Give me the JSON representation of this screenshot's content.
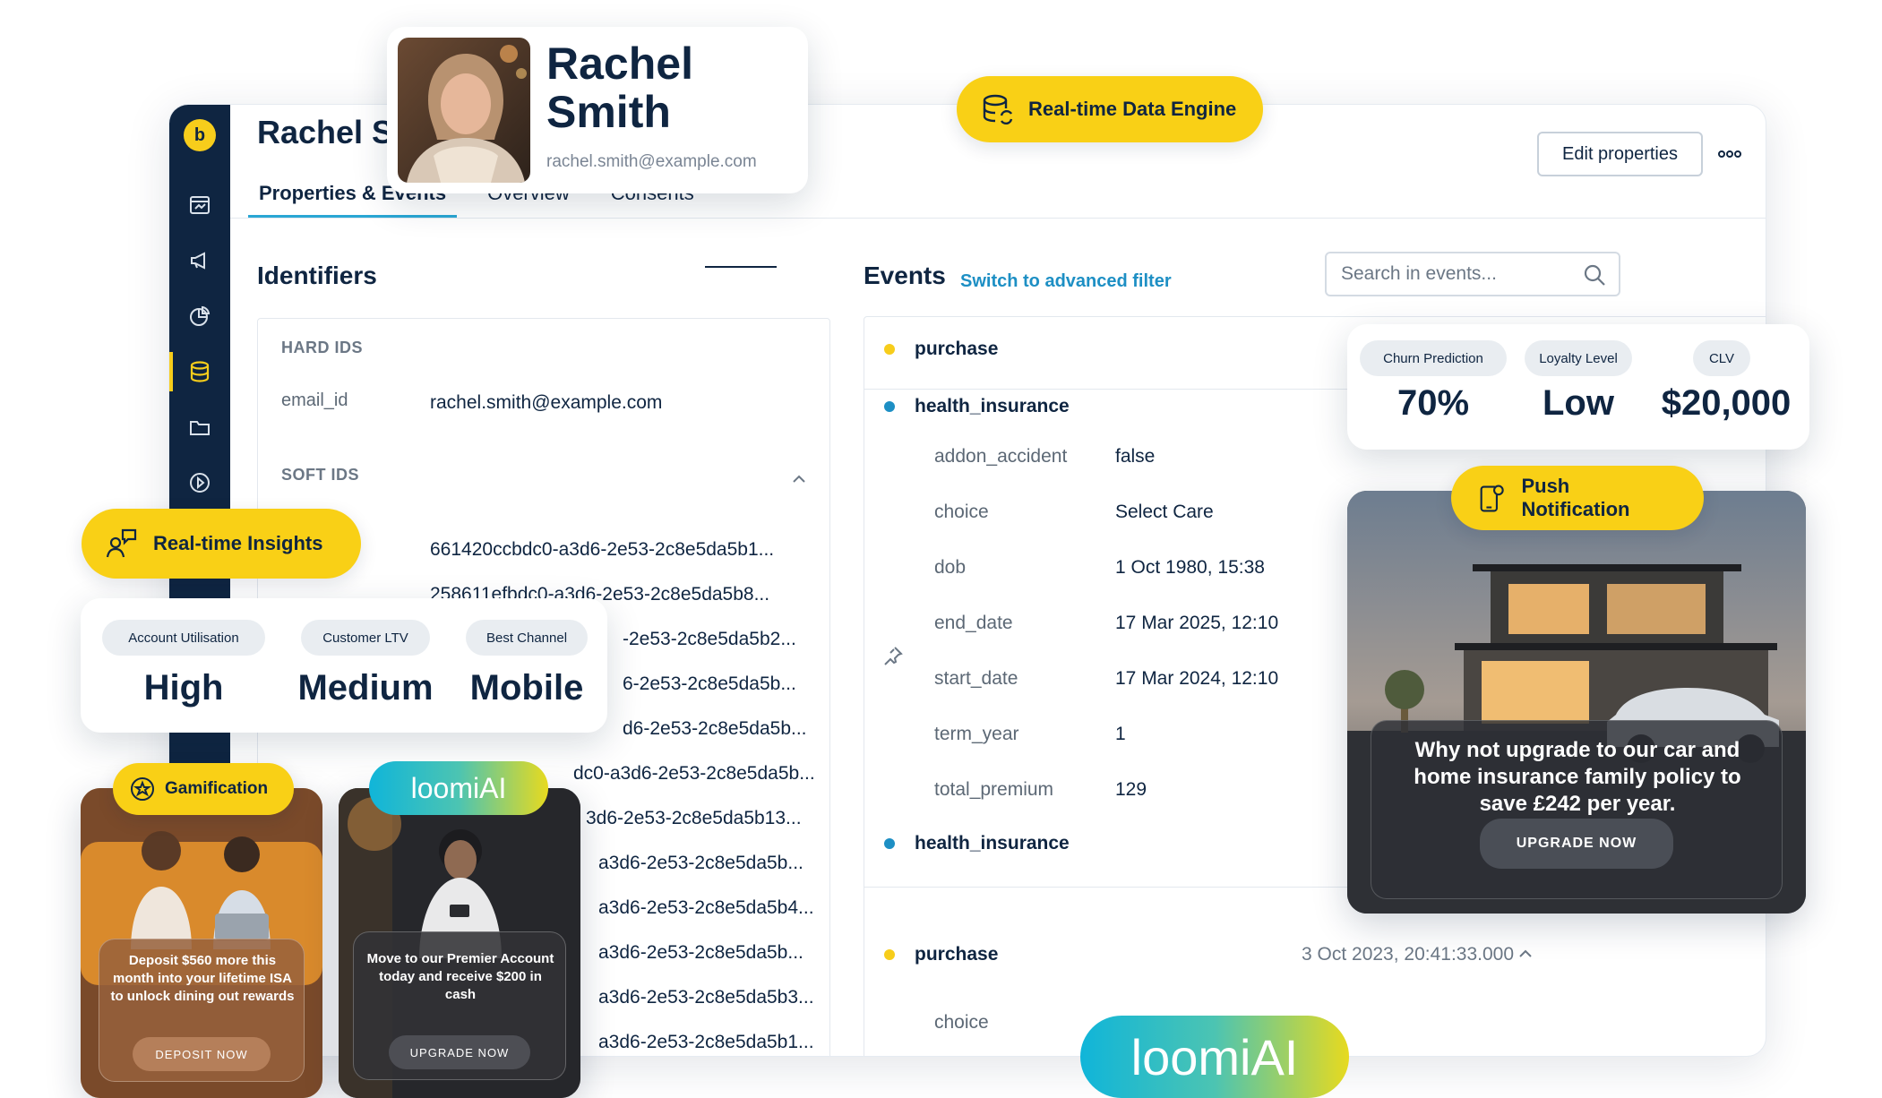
{
  "app": {
    "profile_name": "Rachel S",
    "tabs": [
      {
        "label": "Properties & Events",
        "active": true
      },
      {
        "label": "Overview"
      },
      {
        "label": "Consents"
      }
    ],
    "edit_button": "Edit properties",
    "logo_glyph": "b"
  },
  "identifiers": {
    "title": "Identifiers",
    "hard_ids_label": "HARD IDS",
    "email_key": "email_id",
    "email_value": "rachel.smith@example.com",
    "soft_ids_label": "SOFT IDS",
    "soft_ids": [
      "661420ccbdc0-a3d6-2e53-2c8e5da5b1...",
      "258611efbdc0-a3d6-2e53-2c8e5da5b8...",
      "-2e53-2c8e5da5b2...",
      "6-2e53-2c8e5da5b...",
      "d6-2e53-2c8e5da5b...",
      "dc0-a3d6-2e53-2c8e5da5b...",
      "3d6-2e53-2c8e5da5b13...",
      "a3d6-2e53-2c8e5da5b...",
      "a3d6-2e53-2c8e5da5b4...",
      "a3d6-2e53-2c8e5da5b...",
      "a3d6-2e53-2c8e5da5b3...",
      "a3d6-2e53-2c8e5da5b1..."
    ]
  },
  "events": {
    "title": "Events",
    "advanced_filter": "Switch to advanced filter",
    "search_placeholder": "Search in events...",
    "first_event": "purchase",
    "second_event": "health_insurance",
    "properties": [
      {
        "key": "addon_accident",
        "value": "false"
      },
      {
        "key": "choice",
        "value": "Select Care"
      },
      {
        "key": "dob",
        "value": "1 Oct 1980, 15:38"
      },
      {
        "key": "end_date",
        "value": "17 Mar 2025, 12:10"
      },
      {
        "key": "start_date",
        "value": "17 Mar 2024, 12:10"
      },
      {
        "key": "term_year",
        "value": "1"
      },
      {
        "key": "total_premium",
        "value": "129"
      }
    ],
    "third_event": "health_insurance",
    "fourth_event": "purchase",
    "fourth_time": "3 Oct 2023, 20:41:33.000",
    "fourth_prop": "choice",
    "colors": {
      "yellow": "#f7cd1b",
      "blue": "#1d8fc4"
    }
  },
  "rachel_card": {
    "name": "Rachel Smith",
    "email": "rachel.smith@example.com"
  },
  "pills": {
    "data_engine": "Real-time Data Engine",
    "insights": "Real-time Insights",
    "push": "Push Notification",
    "gamification": "Gamification"
  },
  "metrics_right": [
    {
      "label": "Churn Prediction",
      "value": "70%"
    },
    {
      "label": "Loyalty Level",
      "value": "Low"
    },
    {
      "label": "CLV",
      "value": "$20,000"
    }
  ],
  "metrics_left": [
    {
      "label": "Account Utilisation",
      "value": "High"
    },
    {
      "label": "Customer LTV",
      "value": "Medium"
    },
    {
      "label": "Best Channel",
      "value": "Mobile"
    }
  ],
  "push_card": {
    "message": "Why not upgrade to our car and home insurance family policy to save £242 per year.",
    "cta": "UPGRADE NOW"
  },
  "gamification_card": {
    "message": "Deposit $560 more this month into your lifetime ISA to unlock dining out rewards",
    "cta": "DEPOSIT NOW"
  },
  "loomi_card": {
    "badge": "loomiAI",
    "message": "Move to our Premier Account today and receive $200 in cash",
    "cta": "UPGRADE NOW"
  },
  "loomi_big": "loomiAI"
}
